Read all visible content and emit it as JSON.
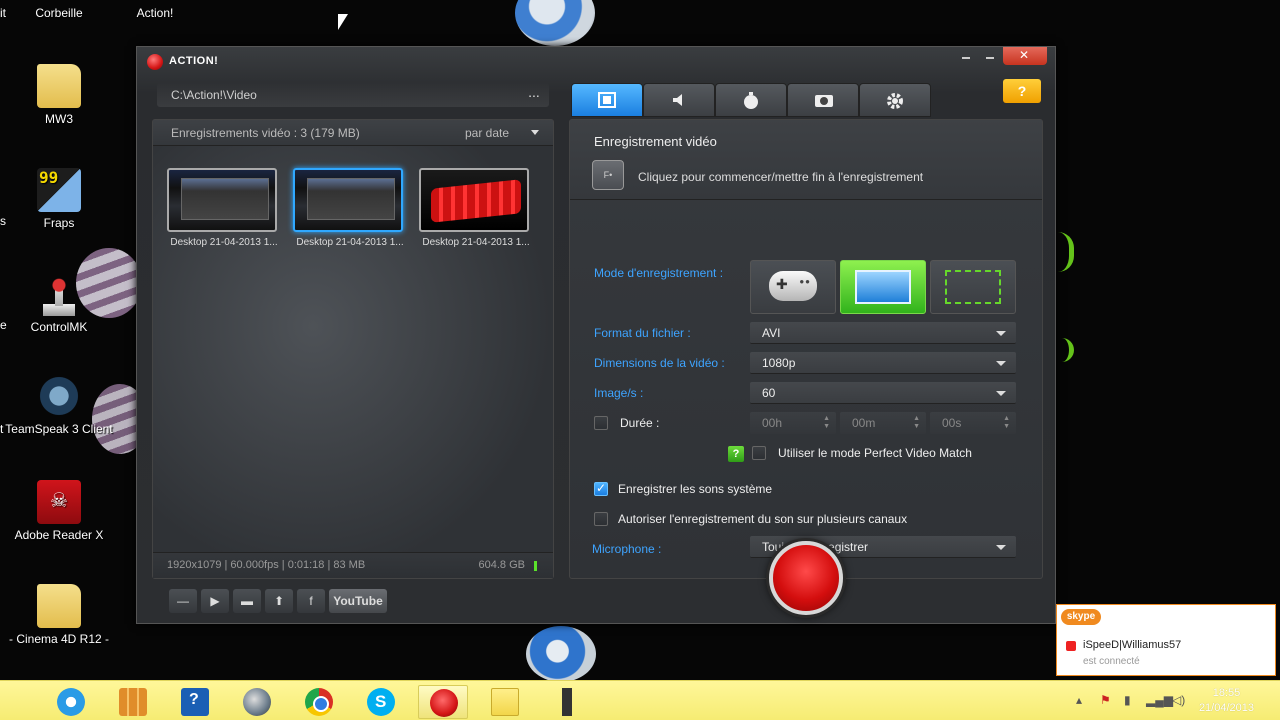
{
  "desktop": {
    "top_labels": [
      "Corbeille",
      "Action!"
    ],
    "top_edge_label": "it",
    "icons": [
      {
        "name": "folder-icon",
        "label": "MW3"
      },
      {
        "name": "fraps-icon",
        "label": "Fraps"
      },
      {
        "name": "joystick-icon",
        "label": "ControlMK"
      },
      {
        "name": "teamspeak-icon",
        "label": "TeamSpeak 3 Client"
      },
      {
        "name": "pdf-icon",
        "label": "Adobe Reader X"
      },
      {
        "name": "folder-icon",
        "label": "- Cinema 4D R12 -"
      }
    ],
    "edge_labels": [
      "s",
      "e",
      "t"
    ]
  },
  "window": {
    "title": "ACTION!",
    "path": "C:\\Action!\\Video",
    "path_more": "...",
    "recordings": {
      "count_label": "Enregistrements vidéo : 3 (179 MB)",
      "sort_label": "par date",
      "items": [
        {
          "caption": "Desktop 21-04-2013 1...",
          "selected": false
        },
        {
          "caption": "Desktop 21-04-2013 1...",
          "selected": true
        },
        {
          "caption": "Desktop 21-04-2013 1...",
          "selected": false
        }
      ],
      "file_info": "1920x1079 | 60.000fps | 0:01:18 | 83 MB",
      "disk_free": "604.8 GB"
    },
    "toolbar": {
      "minus": "—",
      "play": "▶",
      "folder": "▬",
      "upload": "⬆",
      "facebook": "f",
      "youtube": "YouTube"
    },
    "tabs": [
      "video-tab",
      "audio-tab",
      "benchmark-tab",
      "screenshot-tab",
      "settings-tab"
    ],
    "help_glyph": "?",
    "video": {
      "section_title": "Enregistrement vidéo",
      "hotkey": "F•",
      "hotkey_hint": "Cliquez pour commencer/mettre fin à l'enregistrement",
      "mode_label": "Mode d'enregistrement :",
      "format_label": "Format du fichier :",
      "format_value": "AVI",
      "size_label": "Dimensions de la vidéo :",
      "size_value": "1080p",
      "fps_label": "Image/s :",
      "fps_value": "60",
      "duration_label": "Durée :",
      "duration": {
        "hours": "00h",
        "minutes": "00m",
        "seconds": "00s"
      },
      "pvm_label": "Utiliser le mode Perfect Video Match",
      "system_sound_label": "Enregistrer les sons système",
      "multichannel_label": "Autoriser l'enregistrement du son sur plusieurs canaux",
      "mic_label": "Microphone :",
      "mic_value": "Toujours enregistrer"
    }
  },
  "toast": {
    "brand": "skype",
    "contact": "iSpeeD|Williamus57",
    "status": "est connecté"
  },
  "taskbar": {
    "time": "18:55",
    "date": "21/04/2013"
  },
  "colors": {
    "accent_blue": "#3ea4ff",
    "record_red": "#d40e0e",
    "active_green": "#31b31c",
    "taskbar_yellow": "#f6ec73",
    "skype_orange": "#f08a1f"
  }
}
